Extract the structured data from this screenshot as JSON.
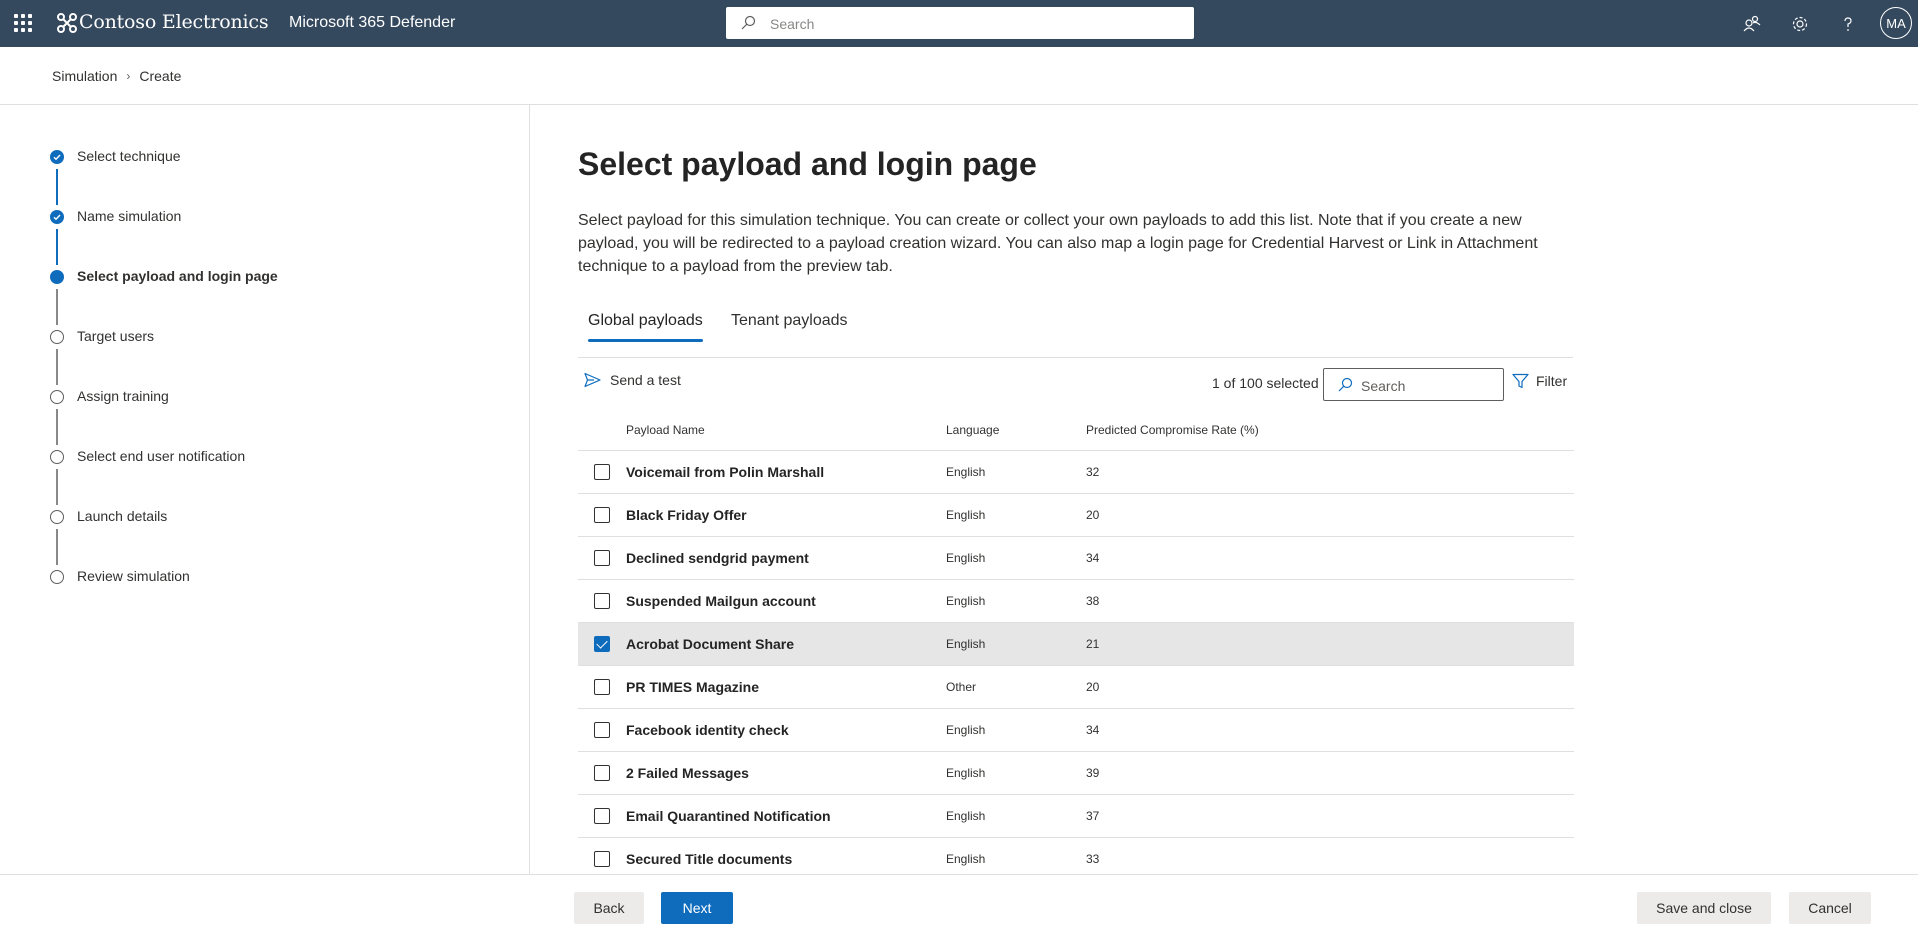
{
  "topbar": {
    "brand": "Contoso Electronics",
    "product": "Microsoft 365 Defender",
    "search_placeholder": "Search",
    "avatar_initials": "MA"
  },
  "breadcrumb": {
    "items": [
      "Simulation",
      "Create"
    ]
  },
  "wizard": {
    "steps": [
      {
        "label": "Select technique",
        "state": "done"
      },
      {
        "label": "Name simulation",
        "state": "done"
      },
      {
        "label": "Select payload and login page",
        "state": "current"
      },
      {
        "label": "Target users",
        "state": "pending"
      },
      {
        "label": "Assign training",
        "state": "pending"
      },
      {
        "label": "Select end user notification",
        "state": "pending"
      },
      {
        "label": "Launch details",
        "state": "pending"
      },
      {
        "label": "Review simulation",
        "state": "pending"
      }
    ]
  },
  "main": {
    "title": "Select payload and login page",
    "description": "Select payload for this simulation technique. You can create or collect your own payloads to add this list. Note that if you create a new payload, you will be redirected to a payload creation wizard. You can also map a login page for Credential Harvest or Link in Attachment technique to a payload from the preview tab.",
    "tabs": [
      {
        "label": "Global payloads",
        "active": true
      },
      {
        "label": "Tenant payloads",
        "active": false
      }
    ]
  },
  "toolbar": {
    "send_test": "Send a test",
    "selected_count": "1 of 100 selected",
    "search_placeholder": "Search",
    "filter": "Filter"
  },
  "table": {
    "columns": [
      "Payload Name",
      "Language",
      "Predicted Compromise Rate (%)"
    ],
    "rows": [
      {
        "name": "Voicemail from Polin Marshall",
        "language": "English",
        "rate": "32",
        "selected": false
      },
      {
        "name": "Black Friday Offer",
        "language": "English",
        "rate": "20",
        "selected": false
      },
      {
        "name": "Declined sendgrid payment",
        "language": "English",
        "rate": "34",
        "selected": false
      },
      {
        "name": "Suspended Mailgun account",
        "language": "English",
        "rate": "38",
        "selected": false
      },
      {
        "name": "Acrobat Document Share",
        "language": "English",
        "rate": "21",
        "selected": true
      },
      {
        "name": "PR TIMES Magazine",
        "language": "Other",
        "rate": "20",
        "selected": false
      },
      {
        "name": "Facebook identity check",
        "language": "English",
        "rate": "34",
        "selected": false
      },
      {
        "name": "2 Failed Messages",
        "language": "English",
        "rate": "39",
        "selected": false
      },
      {
        "name": "Email Quarantined Notification",
        "language": "English",
        "rate": "37",
        "selected": false
      },
      {
        "name": "Secured Title documents",
        "language": "English",
        "rate": "33",
        "selected": false
      }
    ]
  },
  "footer": {
    "back": "Back",
    "next": "Next",
    "save_close": "Save and close",
    "cancel": "Cancel"
  },
  "colors": {
    "topbar": "#35495e",
    "accent": "#0f6cbd",
    "selected_row": "#e6e6e6"
  }
}
